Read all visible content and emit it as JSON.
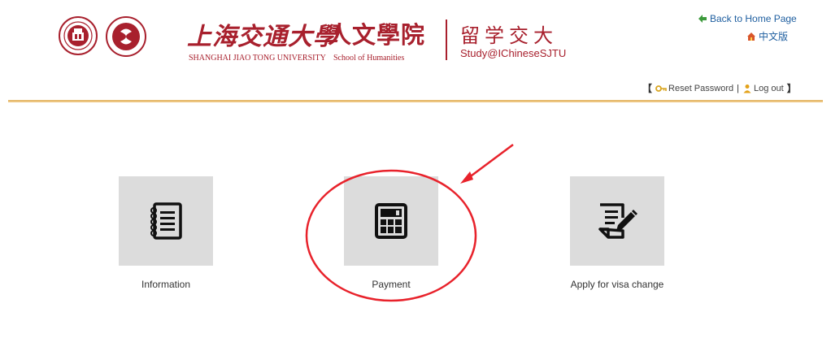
{
  "header": {
    "university_cn": "上海交通大學",
    "university_en": "SHANGHAI JIAO TONG UNIVERSITY",
    "school_cn": "人文學院",
    "school_en": "School of Humanities",
    "portal_cn": "留学交大",
    "portal_en": "Study@IChineseSJTU",
    "home_link": "Back to Home Page",
    "lang_link": "中文版",
    "reset_password": "Reset Password",
    "logout": "Log out",
    "bracket_open": "【",
    "bracket_close": "】",
    "separator": "|"
  },
  "menu": {
    "items": [
      {
        "label": "Information",
        "icon": "notebook-icon"
      },
      {
        "label": "Payment",
        "icon": "calculator-icon"
      },
      {
        "label": "Apply for visa change",
        "icon": "edit-document-icon"
      }
    ]
  },
  "colors": {
    "brand_red": "#a8202d",
    "divider_gold": "#e1b160",
    "tile_gray": "#dcdcdc",
    "annotation_red": "#e8222b"
  },
  "annotation": {
    "type": "circle-with-arrow",
    "target": "Payment"
  }
}
